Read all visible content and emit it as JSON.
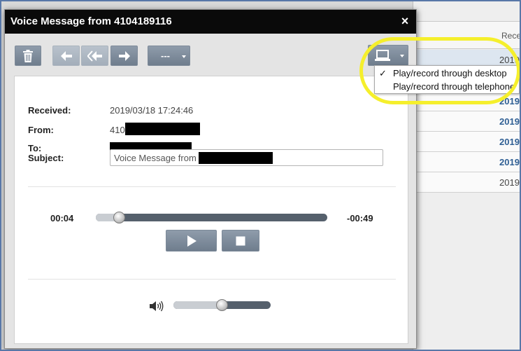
{
  "list": {
    "header_label": "Rece",
    "rows": [
      "2019",
      "2019",
      "2019",
      "2019",
      "2019",
      "2019/"
    ]
  },
  "dialog": {
    "title": "Voice Message from 4104189116",
    "close_glyph": "×"
  },
  "toolbar": {
    "more_label": "---"
  },
  "fields": {
    "received_label": "Received:",
    "received_value": "2019/03/18 17:24:46",
    "from_label": "From:",
    "from_value": "410",
    "to_label": "To:",
    "subject_label": "Subject:",
    "subject_value": "Voice Message from"
  },
  "player": {
    "elapsed": "00:04",
    "remaining": "-00:49",
    "progress_fraction": 0.08,
    "volume_fraction": 0.5
  },
  "device_menu": {
    "check_glyph": "✓",
    "items": [
      {
        "label": "Play/record through desktop",
        "selected": true
      },
      {
        "label": "Play/record through telephone",
        "selected": false
      }
    ]
  },
  "icons": {
    "delete": "trash-icon",
    "reply": "reply-icon",
    "reply_all": "reply-all-icon",
    "forward": "forward-icon",
    "device": "computer-monitor-icon",
    "play": "play-icon",
    "stop": "stop-icon",
    "volume": "speaker-icon"
  },
  "colors": {
    "highlight_ring": "#f5ef2c",
    "link_blue": "#2f5f94",
    "button_gray": "#7d8a99"
  }
}
